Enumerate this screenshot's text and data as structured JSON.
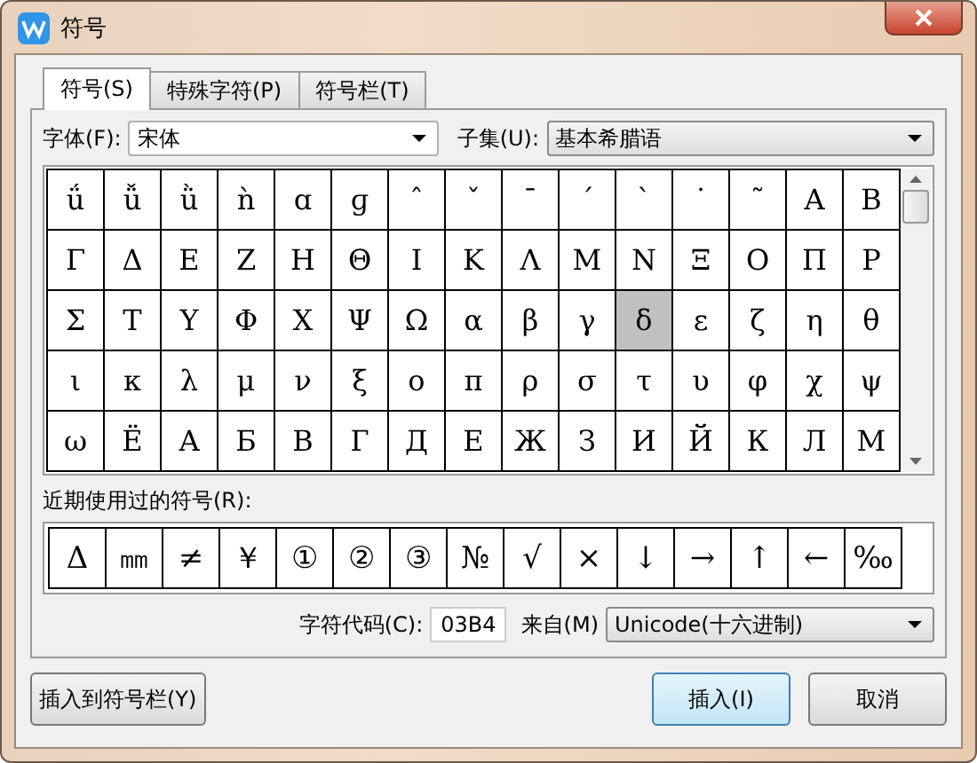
{
  "window": {
    "title": "符号"
  },
  "tabs": [
    {
      "label": "符号(S)",
      "selected": true
    },
    {
      "label": "特殊字符(P)",
      "selected": false
    },
    {
      "label": "符号栏(T)",
      "selected": false
    }
  ],
  "font": {
    "label": "字体(F):",
    "value": "宋体"
  },
  "subset": {
    "label": "子集(U):",
    "value": "基本希腊语"
  },
  "grid": [
    [
      {
        "char": "ǘ",
        "selected": false
      },
      {
        "char": "ǚ",
        "selected": false
      },
      {
        "char": "ǜ",
        "selected": false
      },
      {
        "char": "ǹ",
        "selected": false
      },
      {
        "char": "ɑ",
        "selected": false
      },
      {
        "char": "ɡ",
        "selected": false
      },
      {
        "char": "ˆ",
        "selected": false
      },
      {
        "char": "ˇ",
        "selected": false
      },
      {
        "char": "ˉ",
        "selected": false
      },
      {
        "char": "ˊ",
        "selected": false
      },
      {
        "char": "ˋ",
        "selected": false
      },
      {
        "char": "˙",
        "selected": false
      },
      {
        "char": "˜",
        "selected": false
      },
      {
        "char": "Α",
        "selected": false
      },
      {
        "char": "Β",
        "selected": false
      }
    ],
    [
      {
        "char": "Γ",
        "selected": false
      },
      {
        "char": "Δ",
        "selected": false
      },
      {
        "char": "Ε",
        "selected": false
      },
      {
        "char": "Ζ",
        "selected": false
      },
      {
        "char": "Η",
        "selected": false
      },
      {
        "char": "Θ",
        "selected": false
      },
      {
        "char": "Ι",
        "selected": false
      },
      {
        "char": "Κ",
        "selected": false
      },
      {
        "char": "Λ",
        "selected": false
      },
      {
        "char": "Μ",
        "selected": false
      },
      {
        "char": "Ν",
        "selected": false
      },
      {
        "char": "Ξ",
        "selected": false
      },
      {
        "char": "Ο",
        "selected": false
      },
      {
        "char": "Π",
        "selected": false
      },
      {
        "char": "Ρ",
        "selected": false
      }
    ],
    [
      {
        "char": "Σ",
        "selected": false
      },
      {
        "char": "Τ",
        "selected": false
      },
      {
        "char": "Υ",
        "selected": false
      },
      {
        "char": "Φ",
        "selected": false
      },
      {
        "char": "Χ",
        "selected": false
      },
      {
        "char": "Ψ",
        "selected": false
      },
      {
        "char": "Ω",
        "selected": false
      },
      {
        "char": "α",
        "selected": false
      },
      {
        "char": "β",
        "selected": false
      },
      {
        "char": "γ",
        "selected": false
      },
      {
        "char": "δ",
        "selected": true
      },
      {
        "char": "ε",
        "selected": false
      },
      {
        "char": "ζ",
        "selected": false
      },
      {
        "char": "η",
        "selected": false
      },
      {
        "char": "θ",
        "selected": false
      }
    ],
    [
      {
        "char": "ι",
        "selected": false
      },
      {
        "char": "κ",
        "selected": false
      },
      {
        "char": "λ",
        "selected": false
      },
      {
        "char": "μ",
        "selected": false
      },
      {
        "char": "ν",
        "selected": false
      },
      {
        "char": "ξ",
        "selected": false
      },
      {
        "char": "ο",
        "selected": false
      },
      {
        "char": "π",
        "selected": false
      },
      {
        "char": "ρ",
        "selected": false
      },
      {
        "char": "σ",
        "selected": false
      },
      {
        "char": "τ",
        "selected": false
      },
      {
        "char": "υ",
        "selected": false
      },
      {
        "char": "φ",
        "selected": false
      },
      {
        "char": "χ",
        "selected": false
      },
      {
        "char": "ψ",
        "selected": false
      }
    ],
    [
      {
        "char": "ω",
        "selected": false
      },
      {
        "char": "Ё",
        "selected": false
      },
      {
        "char": "А",
        "selected": false
      },
      {
        "char": "Б",
        "selected": false
      },
      {
        "char": "В",
        "selected": false
      },
      {
        "char": "Г",
        "selected": false
      },
      {
        "char": "Д",
        "selected": false
      },
      {
        "char": "Е",
        "selected": false
      },
      {
        "char": "Ж",
        "selected": false
      },
      {
        "char": "З",
        "selected": false
      },
      {
        "char": "И",
        "selected": false
      },
      {
        "char": "Й",
        "selected": false
      },
      {
        "char": "К",
        "selected": false
      },
      {
        "char": "Л",
        "selected": false
      },
      {
        "char": "М",
        "selected": false
      }
    ]
  ],
  "recent": {
    "label": "近期使用过的符号(R):",
    "symbols": [
      "Δ",
      "㎜",
      "≠",
      "￥",
      "①",
      "②",
      "③",
      "№",
      "√",
      "×",
      "↓",
      "→",
      "↑",
      "←",
      "‰"
    ]
  },
  "code": {
    "label": "字符代码(C):",
    "value": "03B4"
  },
  "from": {
    "label": "来自(M)",
    "value": "Unicode(十六进制)"
  },
  "buttons": [
    {
      "label": "插入到符号栏(Y)",
      "kind": "normal"
    },
    {
      "label": "插入(I)",
      "kind": "default"
    },
    {
      "label": "取消",
      "kind": "normal"
    }
  ]
}
